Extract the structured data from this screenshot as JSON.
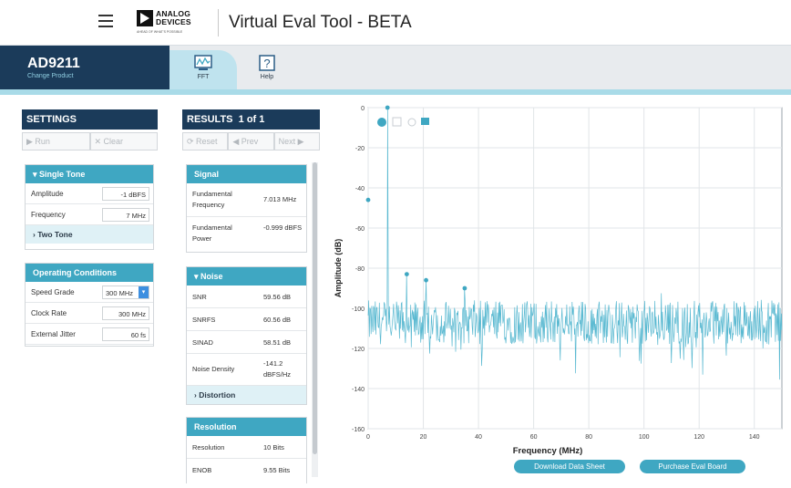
{
  "header": {
    "logo_text": "ANALOG DEVICES",
    "logo_tagline": "AHEAD OF WHAT'S POSSIBLE",
    "title": "Virtual Eval Tool - BETA"
  },
  "part": {
    "name": "AD9211",
    "subtitle": "Change Product"
  },
  "tabs": [
    {
      "label": "FFT"
    },
    {
      "label": "Help"
    }
  ],
  "settings": {
    "title": "SETTINGS",
    "buttons": {
      "run": "▶ Run",
      "clear": "✕ Clear"
    },
    "single_tone": {
      "header": "Single Tone",
      "amplitude_label": "Amplitude",
      "amplitude_value": "-1 dBFS",
      "frequency_label": "Frequency",
      "frequency_value": "7 MHz",
      "two_tone_label": "Two Tone"
    },
    "operating": {
      "header": "Operating Conditions",
      "speed_label": "Speed Grade",
      "speed_value": "300 MHz",
      "clock_label": "Clock Rate",
      "clock_value": "300 MHz",
      "jitter_label": "External Jitter",
      "jitter_value": "60 fs"
    }
  },
  "results": {
    "title": "RESULTS",
    "page": "1 of 1",
    "buttons": {
      "reset": "⟳ Reset",
      "prev": "◀ Prev",
      "next": "Next ▶"
    },
    "signal": {
      "header": "Signal",
      "fund_freq_label": "Fundamental Frequency",
      "fund_freq_value": "7.013 MHz",
      "fund_power_label": "Fundamental Power",
      "fund_power_value": "-0.999 dBFS"
    },
    "noise": {
      "header": "Noise",
      "snr_label": "SNR",
      "snr_value": "59.56 dB",
      "snrfs_label": "SNRFS",
      "snrfs_value": "60.56 dB",
      "sinad_label": "SINAD",
      "sinad_value": "58.51 dB",
      "density_label": "Noise Density",
      "density_value": "-141.2 dBFS/Hz",
      "distortion_label": "Distortion"
    },
    "resolution": {
      "header": "Resolution",
      "res_label": "Resolution",
      "res_value": "10 Bits",
      "enob_label": "ENOB",
      "enob_value": "9.55 Bits"
    }
  },
  "plot_buttons": {
    "datasheet": "Download Data Sheet",
    "purchase": "Purchase Eval Board"
  },
  "colors": {
    "navy": "#1b3b5a",
    "teal": "#3fa7c2",
    "trace": "#5ab9d1"
  },
  "chart_data": {
    "type": "line",
    "title": "",
    "xlabel": "Frequency (MHz)",
    "ylabel": "Amplitude (dB)",
    "xlim": [
      0,
      150
    ],
    "ylim": [
      -160,
      0
    ],
    "x_ticks": [
      0,
      20,
      40,
      60,
      80,
      100,
      120,
      140
    ],
    "y_ticks": [
      0,
      -20,
      -40,
      -60,
      -80,
      -100,
      -120,
      -140,
      -160
    ],
    "noise_floor_db": [
      -96,
      -118
    ],
    "series": [
      {
        "tone_x": 7,
        "tone_y": -1,
        "harmonics": [
          {
            "x": 14,
            "y": -83
          },
          {
            "x": 21,
            "y": -86
          },
          {
            "x": 35,
            "y": -90
          }
        ]
      }
    ],
    "markers": [
      {
        "x": 7,
        "y": 0
      },
      {
        "x": 0,
        "y": -46
      },
      {
        "x": 14,
        "y": -83
      },
      {
        "x": 21,
        "y": -86
      },
      {
        "x": 35,
        "y": -90
      }
    ],
    "grid": true
  }
}
